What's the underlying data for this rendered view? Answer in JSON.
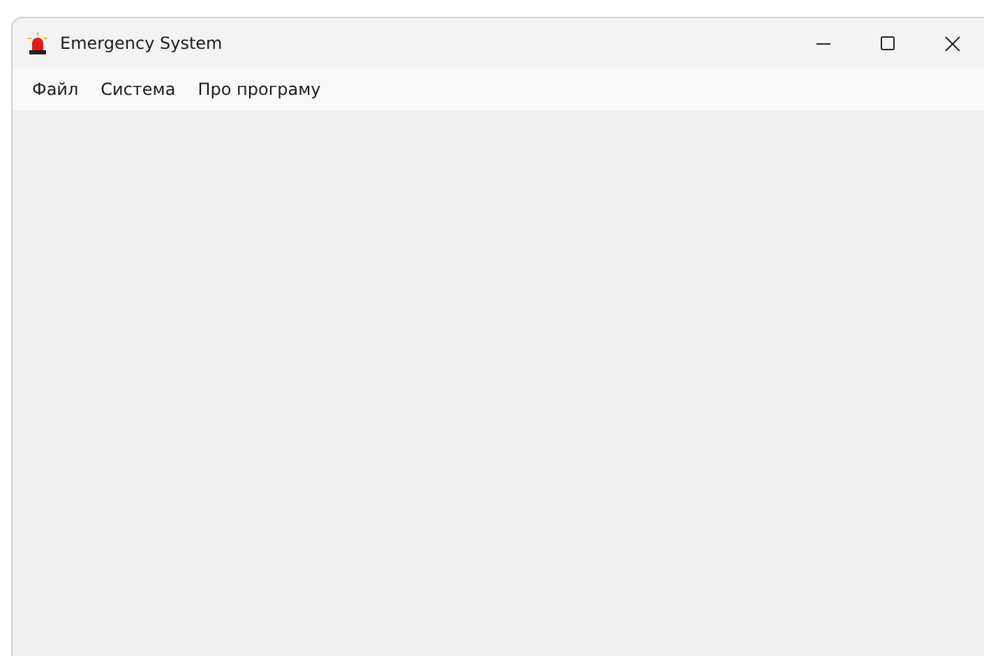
{
  "window": {
    "title": "Emergency System"
  },
  "menu": [
    {
      "label": "Файл"
    },
    {
      "label": "Система"
    },
    {
      "label": "Про програму"
    }
  ]
}
